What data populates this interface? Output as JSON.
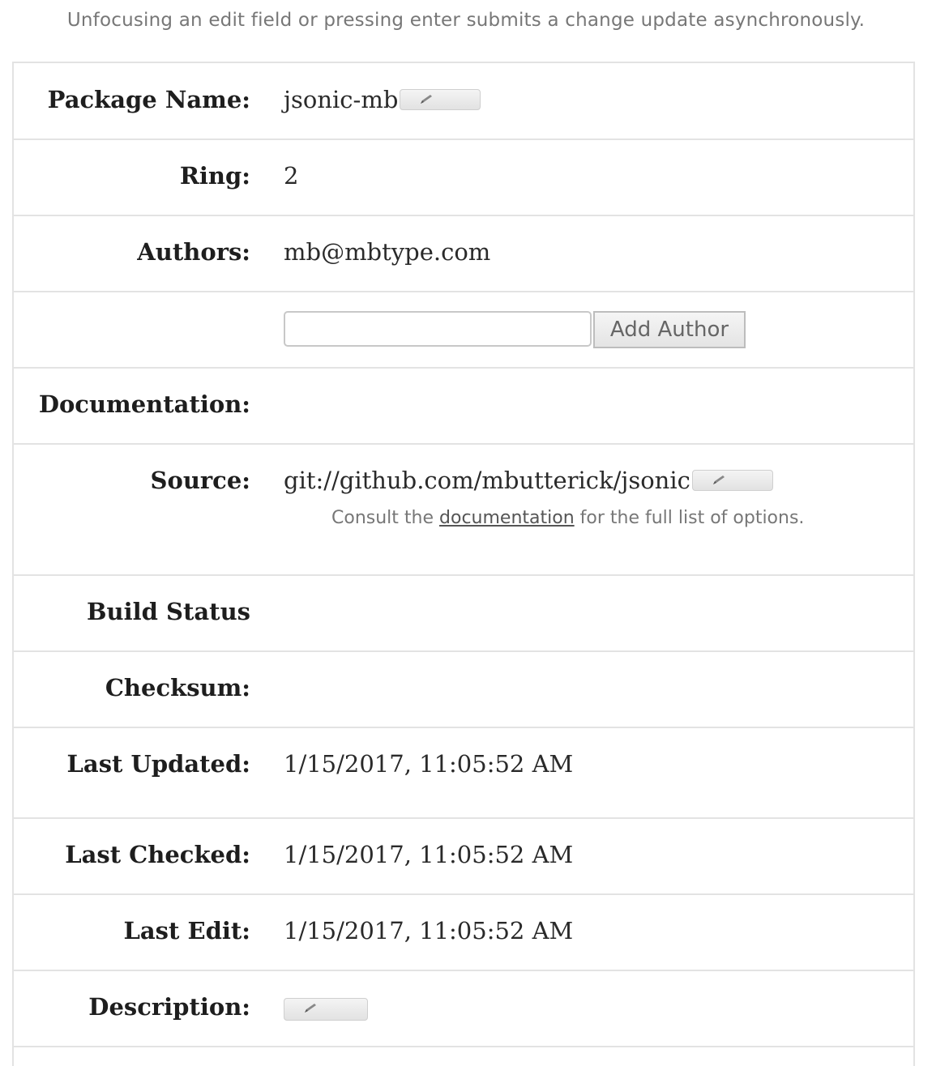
{
  "notice": "Unfocusing an edit field or pressing enter submits a change update asynchronously.",
  "fields": {
    "package_name": {
      "label": "Package Name:",
      "value": "jsonic-mb"
    },
    "ring": {
      "label": "Ring:",
      "value": "2"
    },
    "authors": {
      "label": "Authors:",
      "value": "mb@mbtype.com"
    },
    "add_author": {
      "input_value": "",
      "button_label": "Add Author"
    },
    "documentation": {
      "label": "Documentation:",
      "value": ""
    },
    "source": {
      "label": "Source:",
      "value": "git://github.com/mbutterick/jsonic",
      "hint_prefix": "Consult the",
      "hint_link": "documentation",
      "hint_suffix": "for the full list of options."
    },
    "build_status": {
      "label": "Build Status",
      "value": ""
    },
    "checksum": {
      "label": "Checksum:",
      "value": ""
    },
    "last_updated": {
      "label": "Last Updated:",
      "value": "1/15/2017, 11:05:52 AM"
    },
    "last_checked": {
      "label": "Last Checked:",
      "value": "1/15/2017, 11:05:52 AM"
    },
    "last_edit": {
      "label": "Last Edit:",
      "value": "1/15/2017, 11:05:52 AM"
    },
    "description": {
      "label": "Description:",
      "value": ""
    }
  },
  "icons": {
    "edit": "pencil-icon"
  }
}
